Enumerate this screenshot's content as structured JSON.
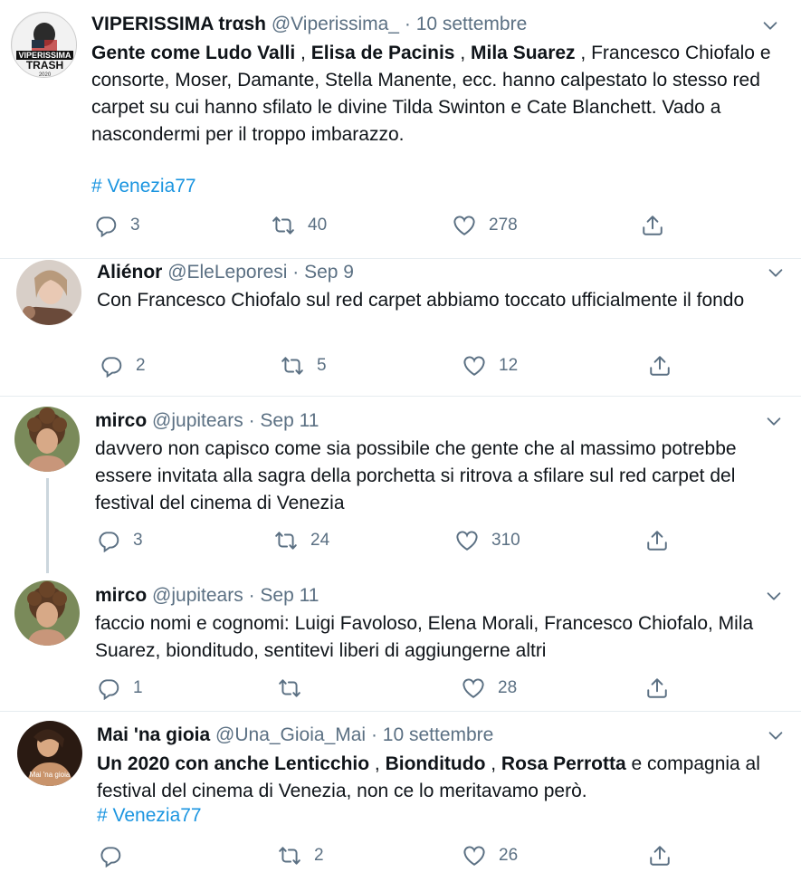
{
  "tweets": [
    {
      "name": "VIPERISSIMA trαsh",
      "handle": "@Viperissima_",
      "date": "10 settembre",
      "avatar_text": [
        "VIPERISSIMA",
        "TRASH",
        "2020"
      ],
      "text_parts": [
        {
          "t": "Gente come Ludo Valli",
          "b": true
        },
        {
          "t": " , ",
          "b": false
        },
        {
          "t": "Elisa de Pacinis",
          "b": true
        },
        {
          "t": " , ",
          "b": false
        },
        {
          "t": "Mila Suarez",
          "b": true
        },
        {
          "t": " , Francesco Chiofalo e consorte, Moser, Damante, Stella Manente, ecc. hanno calpestato lo stesso red carpet su cui hanno sfilato le divine Tilda Swinton e Cate Blanchett. Vado a nascondermi per il troppo imbarazzo.",
          "b": false
        }
      ],
      "hashtag": "# Venezia77",
      "replies": "3",
      "retweets": "40",
      "likes": "278"
    },
    {
      "name": "Aliénor",
      "handle": "@EleLeporesi",
      "date": "Sep 9",
      "text_parts": [
        {
          "t": "Con Francesco Chiofalo sul red carpet abbiamo toccato ufficialmente il fondo",
          "b": false
        }
      ],
      "replies": "2",
      "retweets": "5",
      "likes": "12"
    },
    {
      "name": "mirco",
      "handle": "@jupitears",
      "date": "Sep 11",
      "text_parts": [
        {
          "t": "davvero non capisco come sia possibile che gente che al massimo potrebbe essere invitata alla sagra della porchetta si ritrova a sfilare sul red carpet del festival del cinema di Venezia",
          "b": false
        }
      ],
      "replies": "3",
      "retweets": "24",
      "likes": "310"
    },
    {
      "name": "mirco",
      "handle": "@jupitears",
      "date": "Sep 11",
      "text_parts": [
        {
          "t": "faccio nomi e cognomi: Luigi Favoloso, Elena Morali, Francesco Chiofalo, Mila Suarez, bionditudo, sentitevi liberi di aggiungerne altri",
          "b": false
        }
      ],
      "replies": "1",
      "retweets": "",
      "likes": "28"
    },
    {
      "name": "Mai 'na gioia",
      "handle": "@Una_Gioia_Mai",
      "date": "10 settembre",
      "avatar_text": [
        "Mai 'na gioia"
      ],
      "text_parts": [
        {
          "t": "Un 2020 con anche Lenticchio",
          "b": true
        },
        {
          "t": " , ",
          "b": false
        },
        {
          "t": "Bionditudo",
          "b": true
        },
        {
          "t": " , ",
          "b": false
        },
        {
          "t": "Rosa Perrotta",
          "b": true
        },
        {
          "t": " e compagnia al festival del cinema di Venezia, non ce lo meritavamo però.",
          "b": false
        }
      ],
      "hashtag": "# Venezia77",
      "replies": "",
      "retweets": "2",
      "likes": "26"
    }
  ],
  "ui": {
    "dot": "·",
    "icons": [
      "reply-icon",
      "retweet-icon",
      "like-icon",
      "share-icon",
      "chevron-down-icon"
    ],
    "colors": {
      "link": "#1b95e0",
      "muted": "#5b7083",
      "text": "#0f1419",
      "thread_line": "#ccd6dd"
    }
  }
}
